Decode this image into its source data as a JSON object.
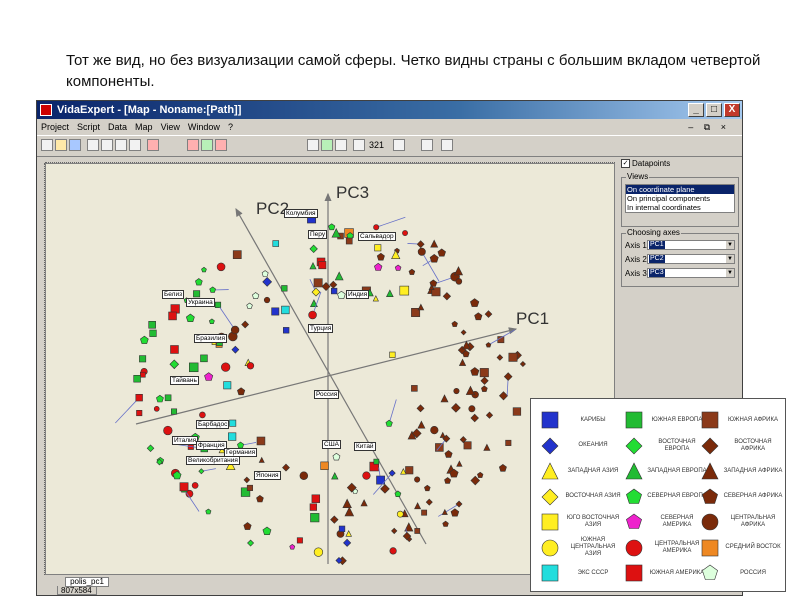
{
  "caption": "Тот же вид, но без визуализации самой сферы. Четко видны страны с большим вкладом четвертой компоненты.",
  "window": {
    "title": "VidaExpert - [Map - Noname:[Path]]",
    "controls": [
      "_",
      "□",
      "X"
    ]
  },
  "menu": {
    "items": [
      "Project",
      "Script",
      "Data",
      "Map",
      "View",
      "Window",
      "?"
    ],
    "mdi_controls": "– ⧉ ×"
  },
  "toolbar": {
    "zoom": "321"
  },
  "plot": {
    "axis_labels": [
      "PC1",
      "PC2",
      "PC3"
    ],
    "point_labels": [
      "Колумбия",
      "Перу",
      "Сальвадор",
      "Белиз",
      "Украина",
      "Индия",
      "Бразилия",
      "Турция",
      "Тайвань",
      "Россия",
      "Барбадос",
      "Италия",
      "Франция",
      "Германия",
      "Великобритания",
      "США",
      "Китай",
      "Япония"
    ]
  },
  "side_panel": {
    "datapoints_label": "Datapoints",
    "datapoints_checked": true,
    "views_title": "Views",
    "views": [
      "On coordinate plane",
      "On principal components",
      "In internal coordinates"
    ],
    "views_selected": 0,
    "choosing_axes_title": "Choosing axes",
    "axes": [
      {
        "label": "Axis 1:",
        "value": "PC1"
      },
      {
        "label": "Axis 2:",
        "value": "PC2"
      },
      {
        "label": "Axis 3:",
        "value": "PC3"
      }
    ]
  },
  "tabs": [
    "polis_pc1"
  ],
  "status": {
    "size": "807x584"
  },
  "legend": {
    "items": [
      {
        "label": "карибы",
        "shape": "square",
        "color": "#2233cc"
      },
      {
        "label": "южная европа",
        "shape": "square",
        "color": "#22bb33"
      },
      {
        "label": "южная африка",
        "shape": "square",
        "color": "#8b3a1a"
      },
      {
        "label": "океания",
        "shape": "diamond",
        "color": "#2233cc"
      },
      {
        "label": "восточная европа",
        "shape": "diamond",
        "color": "#22dd33"
      },
      {
        "label": "восточная африка",
        "shape": "diamond",
        "color": "#7a2a0a"
      },
      {
        "label": "западная азия",
        "shape": "triangle",
        "color": "#ffee22"
      },
      {
        "label": "западная европа",
        "shape": "triangle",
        "color": "#22bb33"
      },
      {
        "label": "западная африка",
        "shape": "triangle",
        "color": "#7a2a0a"
      },
      {
        "label": "восточная азия",
        "shape": "diamond",
        "color": "#ffee22"
      },
      {
        "label": "северная европа",
        "shape": "pentagon",
        "color": "#22dd33"
      },
      {
        "label": "северная африка",
        "shape": "pentagon",
        "color": "#7a2a0a"
      },
      {
        "label": "юго восточная азия",
        "shape": "square",
        "color": "#ffee22"
      },
      {
        "label": "северная америка",
        "shape": "pentagon",
        "color": "#ee22cc"
      },
      {
        "label": "центральная африка",
        "shape": "circle",
        "color": "#7a2a0a"
      },
      {
        "label": "южная центральная азия",
        "shape": "circle",
        "color": "#ffee22"
      },
      {
        "label": "центральная америка",
        "shape": "circle",
        "color": "#dd1111"
      },
      {
        "label": "средний восток",
        "shape": "square",
        "color": "#ee8822"
      },
      {
        "label": "экс ссср",
        "shape": "square",
        "color": "#22dddd"
      },
      {
        "label": "южная америка",
        "shape": "square",
        "color": "#dd1111"
      },
      {
        "label": "россия",
        "shape": "pentagon",
        "color": "#ddffdd"
      }
    ]
  }
}
